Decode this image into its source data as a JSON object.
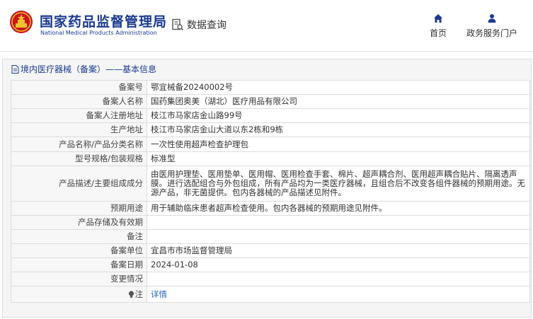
{
  "header": {
    "brand_cn": "国家药品监督管理局",
    "brand_en": "National Medical Products Administration",
    "query_label": "数据查询",
    "nav": [
      {
        "label": "首页",
        "icon": "home-icon"
      },
      {
        "label": "政务服务门户",
        "icon": "user-icon"
      }
    ]
  },
  "panel": {
    "icon": "document-icon",
    "title": "境内医疗器械（备案）——基本信息"
  },
  "rows": [
    {
      "label": "备案号",
      "value": "鄂宜械备20240002号"
    },
    {
      "label": "备案人名称",
      "value": "国药集团奥美（湖北）医疗用品有限公司"
    },
    {
      "label": "备案人注册地址",
      "value": "枝江市马家店金山路99号"
    },
    {
      "label": "生产地址",
      "value": "枝江市马家店金山大道以东2栋和9栋"
    },
    {
      "label": "产品名称/产品分类名称",
      "value": "一次性使用超声检查护理包"
    },
    {
      "label": "型号规格/包装规格",
      "value": "标准型"
    },
    {
      "label": "产品描述/主要组成成分",
      "value": "由医用护理垫、医用垫单、医用帽、医用检查手套、棉片、超声耦合剂、医用超声耦合贴片、隔离透声膜。进行选配组合与外包组成，所有产品均为一类医疗器械，且组合后不改变各组件器械的预期用途。无源产品，非无菌提供。包内各器械的产品描述见附件。"
    },
    {
      "label": "预期用途",
      "value": "用于辅助临床患者超声检查使用。包内各器械的预期用途见附件。"
    },
    {
      "label": "产品存储及有效期",
      "value": ""
    },
    {
      "label": "备注",
      "value": ""
    },
    {
      "label": "备案单位",
      "value": "宜昌市市场监督管理局"
    },
    {
      "label": "备案日期",
      "value": "2024-01-08"
    },
    {
      "label": "变更情况",
      "value": ""
    },
    {
      "label": "注",
      "value": "详情",
      "icon": "lightbulb-icon"
    }
  ],
  "colors": {
    "brand_blue": "#1a3a8f",
    "emblem_red": "#c8161d",
    "emblem_gold": "#f2c12e",
    "link_blue": "#2a63c6"
  }
}
